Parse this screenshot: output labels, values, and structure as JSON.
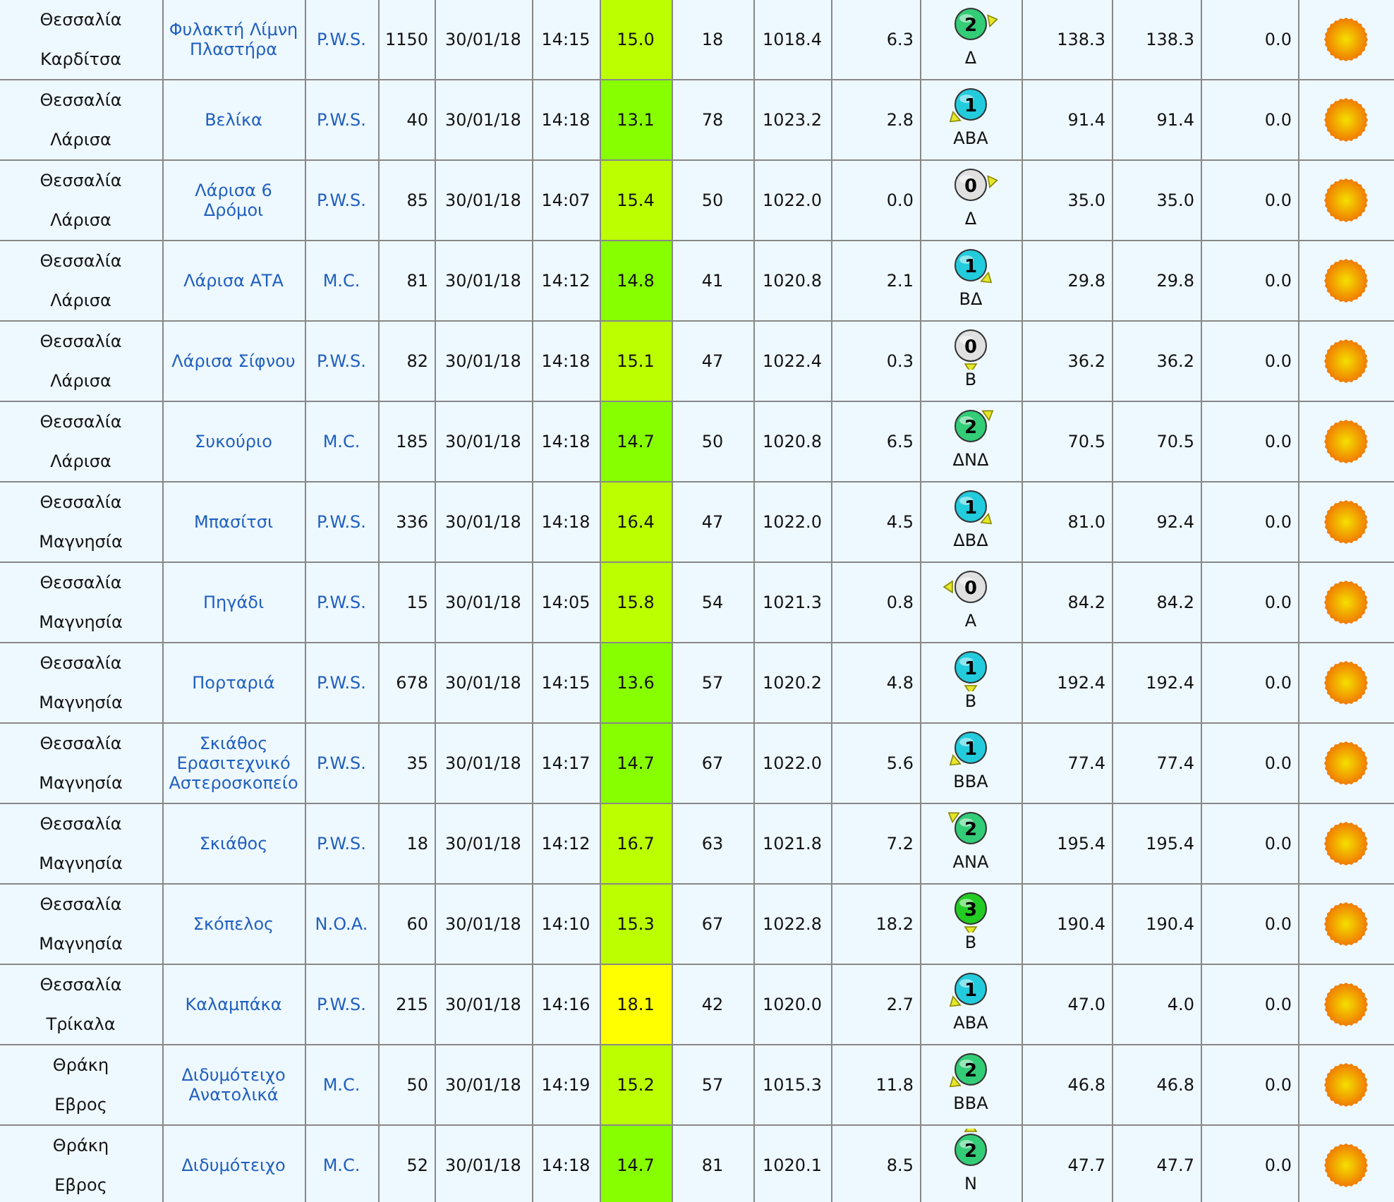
{
  "table": {
    "rows": [
      {
        "column_1": [
          "Θεσσαλία",
          "Καρδίτσα"
        ],
        "column_2": "Φυλακτή Λίμνη Πλαστήρα",
        "column_3": "P.W.S.",
        "column_4": "1150",
        "column_5": "30/01/18",
        "column_6": "14:15",
        "column_7": {
          "text": "15.0",
          "color": "#bbff00"
        },
        "column_8": "18",
        "column_9": "1018.4",
        "column_10": "6.3",
        "column_11": {
          "force": "2",
          "color": "#33cc77",
          "kind": "east",
          "label": "Δ"
        },
        "column_12": "138.3",
        "column_13": "138.3",
        "column_14": "0.0",
        "column_15": {
          "kind": "sun"
        }
      },
      {
        "column_1": [
          "Θεσσαλία",
          "Λάρισα"
        ],
        "column_2": "Βελίκα",
        "column_3": "P.W.S.",
        "column_4": "40",
        "column_5": "30/01/18",
        "column_6": "14:18",
        "column_7": {
          "text": "13.1",
          "color": "#88ff00"
        },
        "column_8": "78",
        "column_9": "1023.2",
        "column_10": "2.8",
        "column_11": {
          "force": "1",
          "color": "#22ccdd",
          "kind": "southwest",
          "label": "ΑΒΑ"
        },
        "column_12": "91.4",
        "column_13": "91.4",
        "column_14": "0.0",
        "column_15": {
          "kind": "sun"
        }
      },
      {
        "column_1": [
          "Θεσσαλία",
          "Λάρισα"
        ],
        "column_2": "Λάρισα 6 Δρόμοι",
        "column_3": "P.W.S.",
        "column_4": "85",
        "column_5": "30/01/18",
        "column_6": "14:07",
        "column_7": {
          "text": "15.4",
          "color": "#bbff00"
        },
        "column_8": "50",
        "column_9": "1022.0",
        "column_10": "0.0",
        "column_11": {
          "force": "0",
          "color": "#e0e0e0",
          "kind": "east",
          "label": "Δ"
        },
        "column_12": "35.0",
        "column_13": "35.0",
        "column_14": "0.0",
        "column_15": {
          "kind": "sun"
        }
      },
      {
        "column_1": [
          "Θεσσαλία",
          "Λάρισα"
        ],
        "column_2": "Λάρισα ΑΤΑ",
        "column_3": "M.C.",
        "column_4": "81",
        "column_5": "30/01/18",
        "column_6": "14:12",
        "column_7": {
          "text": "14.8",
          "color": "#88ff00"
        },
        "column_8": "41",
        "column_9": "1020.8",
        "column_10": "2.1",
        "column_11": {
          "force": "1",
          "color": "#22ccdd",
          "kind": "southeast",
          "label": "ΒΔ"
        },
        "column_12": "29.8",
        "column_13": "29.8",
        "column_14": "0.0",
        "column_15": {
          "kind": "sun"
        }
      },
      {
        "column_1": [
          "Θεσσαλία",
          "Λάρισα"
        ],
        "column_2": "Λάρισα Σίφνου",
        "column_3": "P.W.S.",
        "column_4": "82",
        "column_5": "30/01/18",
        "column_6": "14:18",
        "column_7": {
          "text": "15.1",
          "color": "#bbff00"
        },
        "column_8": "47",
        "column_9": "1022.4",
        "column_10": "0.3",
        "column_11": {
          "force": "0",
          "color": "#e0e0e0",
          "kind": "south",
          "label": "Β"
        },
        "column_12": "36.2",
        "column_13": "36.2",
        "column_14": "0.0",
        "column_15": {
          "kind": "sun"
        }
      },
      {
        "column_1": [
          "Θεσσαλία",
          "Λάρισα"
        ],
        "column_2": "Συκούριο",
        "column_3": "M.C.",
        "column_4": "185",
        "column_5": "30/01/18",
        "column_6": "14:18",
        "column_7": {
          "text": "14.7",
          "color": "#88ff00"
        },
        "column_8": "50",
        "column_9": "1020.8",
        "column_10": "6.5",
        "column_11": {
          "force": "2",
          "color": "#33cc77",
          "kind": "northeast",
          "label": "ΔΝΔ"
        },
        "column_12": "70.5",
        "column_13": "70.5",
        "column_14": "0.0",
        "column_15": {
          "kind": "sun"
        }
      },
      {
        "column_1": [
          "Θεσσαλία",
          "Μαγνησία"
        ],
        "column_2": "Μπασίτσι",
        "column_3": "P.W.S.",
        "column_4": "336",
        "column_5": "30/01/18",
        "column_6": "14:18",
        "column_7": {
          "text": "16.4",
          "color": "#bbff00"
        },
        "column_8": "47",
        "column_9": "1022.0",
        "column_10": "4.5",
        "column_11": {
          "force": "1",
          "color": "#22ccdd",
          "kind": "southeast",
          "label": "ΔΒΔ"
        },
        "column_12": "81.0",
        "column_13": "92.4",
        "column_14": "0.0",
        "column_15": {
          "kind": "sun"
        }
      },
      {
        "column_1": [
          "Θεσσαλία",
          "Μαγνησία"
        ],
        "column_2": "Πηγάδι",
        "column_3": "P.W.S.",
        "column_4": "15",
        "column_5": "30/01/18",
        "column_6": "14:05",
        "column_7": {
          "text": "15.8",
          "color": "#bbff00"
        },
        "column_8": "54",
        "column_9": "1021.3",
        "column_10": "0.8",
        "column_11": {
          "force": "0",
          "color": "#e0e0e0",
          "kind": "west",
          "label": "Α"
        },
        "column_12": "84.2",
        "column_13": "84.2",
        "column_14": "0.0",
        "column_15": {
          "kind": "sun"
        }
      },
      {
        "column_1": [
          "Θεσσαλία",
          "Μαγνησία"
        ],
        "column_2": "Πορταριά",
        "column_3": "P.W.S.",
        "column_4": "678",
        "column_5": "30/01/18",
        "column_6": "14:15",
        "column_7": {
          "text": "13.6",
          "color": "#88ff00"
        },
        "column_8": "57",
        "column_9": "1020.2",
        "column_10": "4.8",
        "column_11": {
          "force": "1",
          "color": "#22ccdd",
          "kind": "south",
          "label": "Β"
        },
        "column_12": "192.4",
        "column_13": "192.4",
        "column_14": "0.0",
        "column_15": {
          "kind": "sun"
        }
      },
      {
        "column_1": [
          "Θεσσαλία",
          "Μαγνησία"
        ],
        "column_2": "Σκιάθος Ερασιτεχνικό Αστεροσκοπείο",
        "column_3": "P.W.S.",
        "column_4": "35",
        "column_5": "30/01/18",
        "column_6": "14:17",
        "column_7": {
          "text": "14.7",
          "color": "#88ff00"
        },
        "column_8": "67",
        "column_9": "1022.0",
        "column_10": "5.6",
        "column_11": {
          "force": "1",
          "color": "#22ccdd",
          "kind": "southwest",
          "label": "ΒΒΑ"
        },
        "column_12": "77.4",
        "column_13": "77.4",
        "column_14": "0.0",
        "column_15": {
          "kind": "sun"
        }
      },
      {
        "column_1": [
          "Θεσσαλία",
          "Μαγνησία"
        ],
        "column_2": "Σκιάθος",
        "column_3": "P.W.S.",
        "column_4": "18",
        "column_5": "30/01/18",
        "column_6": "14:12",
        "column_7": {
          "text": "16.7",
          "color": "#bbff00"
        },
        "column_8": "63",
        "column_9": "1021.8",
        "column_10": "7.2",
        "column_11": {
          "force": "2",
          "color": "#33cc77",
          "kind": "northwest",
          "label": "ΑΝΑ"
        },
        "column_12": "195.4",
        "column_13": "195.4",
        "column_14": "0.0",
        "column_15": {
          "kind": "sun"
        }
      },
      {
        "column_1": [
          "Θεσσαλία",
          "Μαγνησία"
        ],
        "column_2": "Σκόπελος",
        "column_3": "N.O.A.",
        "column_4": "60",
        "column_5": "30/01/18",
        "column_6": "14:10",
        "column_7": {
          "text": "15.3",
          "color": "#bbff00"
        },
        "column_8": "67",
        "column_9": "1022.8",
        "column_10": "18.2",
        "column_11": {
          "force": "3",
          "color": "#22cc22",
          "kind": "south",
          "label": "Β"
        },
        "column_12": "190.4",
        "column_13": "190.4",
        "column_14": "0.0",
        "column_15": {
          "kind": "sun"
        }
      },
      {
        "column_1": [
          "Θεσσαλία",
          "Τρίκαλα"
        ],
        "column_2": "Καλαμπάκα",
        "column_3": "P.W.S.",
        "column_4": "215",
        "column_5": "30/01/18",
        "column_6": "14:16",
        "column_7": {
          "text": "18.1",
          "color": "#ffff00"
        },
        "column_8": "42",
        "column_9": "1020.0",
        "column_10": "2.7",
        "column_11": {
          "force": "1",
          "color": "#22ccdd",
          "kind": "southwest",
          "label": "ΑΒΑ"
        },
        "column_12": "47.0",
        "column_13": "4.0",
        "column_14": "0.0",
        "column_15": {
          "kind": "sun"
        }
      },
      {
        "column_1": [
          "Θράκη",
          "Εβρος"
        ],
        "column_2": "Διδυμότειχο Ανατολικά",
        "column_3": "M.C.",
        "column_4": "50",
        "column_5": "30/01/18",
        "column_6": "14:19",
        "column_7": {
          "text": "15.2",
          "color": "#bbff00"
        },
        "column_8": "57",
        "column_9": "1015.3",
        "column_10": "11.8",
        "column_11": {
          "force": "2",
          "color": "#33cc77",
          "kind": "southwest",
          "label": "ΒΒΑ"
        },
        "column_12": "46.8",
        "column_13": "46.8",
        "column_14": "0.0",
        "column_15": {
          "kind": "sun"
        }
      },
      {
        "column_1": [
          "Θράκη",
          "Εβρος"
        ],
        "column_2": "Διδυμότειχο",
        "column_3": "M.C.",
        "column_4": "52",
        "column_5": "30/01/18",
        "column_6": "14:18",
        "column_7": {
          "text": "14.7",
          "color": "#88ff00"
        },
        "column_8": "81",
        "column_9": "1020.1",
        "column_10": "8.5",
        "column_11": {
          "force": "2",
          "color": "#33cc77",
          "kind": "north",
          "label": "Ν"
        },
        "column_12": "47.7",
        "column_13": "47.7",
        "column_14": "0.0",
        "column_15": {
          "kind": "sun"
        }
      }
    ]
  }
}
